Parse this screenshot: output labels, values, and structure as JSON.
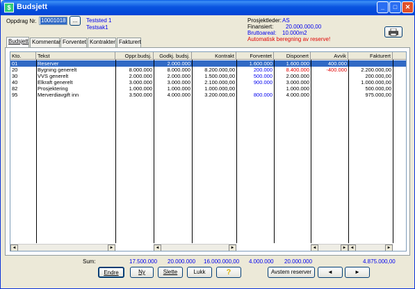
{
  "window": {
    "title": "Budsjett"
  },
  "header": {
    "oppdrag_label": "Oppdrag Nr.",
    "oppdrag_value": "10001018",
    "browse_label": "...",
    "teststed": "Teststed 1",
    "testsak": "Testsak1",
    "prosjektleder_label": "Prosjektleder:",
    "prosjektleder_value": "AS",
    "finansiert_label": "Finansiert:",
    "finansiert_value": "20.000.000,00",
    "bruttoareal_label": "Bruttoareal:",
    "bruttoareal_value": "10.000m2",
    "warning": "Automatisk beregning av reserve!"
  },
  "tabs": [
    {
      "label": "Budsjett"
    },
    {
      "label": "Kommentar"
    },
    {
      "label": "Forventet"
    },
    {
      "label": "Kontrakter"
    },
    {
      "label": "Fakturert"
    }
  ],
  "table": {
    "columns": [
      "Kto.",
      "Tekst",
      "Oppr.budsj.",
      "Godkj. budsj.",
      "Kontrakt",
      "Forventet",
      "Disponert",
      "Avvik",
      "Fakturert"
    ],
    "rows": [
      [
        "01",
        "Reserver",
        "",
        "2.000.000",
        "",
        "1.600.000",
        "1.600.000",
        "400.000",
        ""
      ],
      [
        "20",
        "Bygning generelt",
        "8.000.000",
        "8.000.000",
        "8.200.000,00",
        "200.000",
        "8.400.000",
        "-400.000",
        "2.200.000,00"
      ],
      [
        "30",
        "VVS generelt",
        "2.000.000",
        "2.000.000",
        "1.500.000,00",
        "500.000",
        "2.000.000",
        "",
        "200.000,00"
      ],
      [
        "40",
        "Elkraft generelt",
        "3.000.000",
        "3.000.000",
        "2.100.000,00",
        "900.000",
        "3.000.000",
        "",
        "1.000.000,00"
      ],
      [
        "82",
        "Prosjektering",
        "1.000.000",
        "1.000.000",
        "1.000.000,00",
        "",
        "1.000.000",
        "",
        "500.000,00"
      ],
      [
        "95",
        "Merverdiavgift inn",
        "3.500.000",
        "4.000.000",
        "3.200.000,00",
        "800.000",
        "4.000.000",
        "",
        "975.000,00"
      ]
    ]
  },
  "sums": {
    "label": "Sum:",
    "oppr": "17.500.000",
    "godkj": "20.000.000",
    "kontrakt": "16.000.000,00",
    "forventet": "4.000.000",
    "disponert": "20.000.000",
    "fakturert": "4.875.000,00"
  },
  "buttons": {
    "endre": "Endre",
    "ny": "Ny",
    "slette": "Slette",
    "lukk": "Lukk",
    "help": "?",
    "avstem": "Avstem reserver",
    "prev": "◄",
    "next": "►"
  }
}
